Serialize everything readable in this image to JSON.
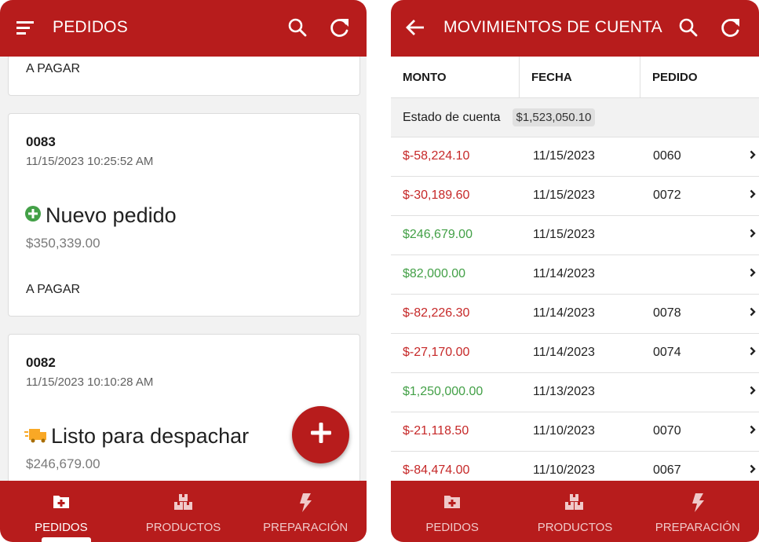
{
  "left": {
    "title": "PEDIDOS",
    "partial_card": {
      "payment": "A PAGAR"
    },
    "orders": [
      {
        "number": "0083",
        "datetime": "11/15/2023 10:25:52 AM",
        "status": "Nuevo pedido",
        "status_icon": "plus-circle-icon",
        "amount": "$350,339.00",
        "payment": "A PAGAR"
      },
      {
        "number": "0082",
        "datetime": "11/15/2023 10:10:28 AM",
        "status": "Listo para despachar",
        "status_icon": "truck-icon",
        "amount": "$246,679.00"
      }
    ],
    "nav": [
      {
        "label": "PEDIDOS",
        "icon": "orders-icon",
        "active": true
      },
      {
        "label": "PRODUCTOS",
        "icon": "boxes-icon",
        "active": false
      },
      {
        "label": "PREPARACIÓN",
        "icon": "bolt-icon",
        "active": false
      }
    ]
  },
  "right": {
    "title": "MOVIMIENTOS DE CUENTA",
    "columns": [
      "MONTO",
      "FECHA",
      "PEDIDO"
    ],
    "account_label": "Estado de cuenta",
    "account_balance": "$1,523,050.10",
    "rows": [
      {
        "amount": "$-58,224.10",
        "date": "11/15/2023",
        "order": "0060",
        "sign": "negative"
      },
      {
        "amount": "$-30,189.60",
        "date": "11/15/2023",
        "order": "0072",
        "sign": "negative"
      },
      {
        "amount": "$246,679.00",
        "date": "11/15/2023",
        "order": "",
        "sign": "positive"
      },
      {
        "amount": "$82,000.00",
        "date": "11/14/2023",
        "order": "",
        "sign": "positive"
      },
      {
        "amount": "$-82,226.30",
        "date": "11/14/2023",
        "order": "0078",
        "sign": "negative"
      },
      {
        "amount": "$-27,170.00",
        "date": "11/14/2023",
        "order": "0074",
        "sign": "negative"
      },
      {
        "amount": "$1,250,000.00",
        "date": "11/13/2023",
        "order": "",
        "sign": "positive"
      },
      {
        "amount": "$-21,118.50",
        "date": "11/10/2023",
        "order": "0070",
        "sign": "negative"
      },
      {
        "amount": "$-84,474.00",
        "date": "11/10/2023",
        "order": "0067",
        "sign": "negative"
      }
    ],
    "nav": [
      {
        "label": "PEDIDOS",
        "icon": "orders-icon",
        "active": false
      },
      {
        "label": "PRODUCTOS",
        "icon": "boxes-icon",
        "active": false
      },
      {
        "label": "PREPARACIÓN",
        "icon": "bolt-icon",
        "active": false
      }
    ]
  },
  "colors": {
    "primary": "#b71c1c",
    "negative": "#c62828",
    "positive": "#43a047",
    "new_order": "#43a047",
    "ready_dispatch": "#f9a825"
  }
}
